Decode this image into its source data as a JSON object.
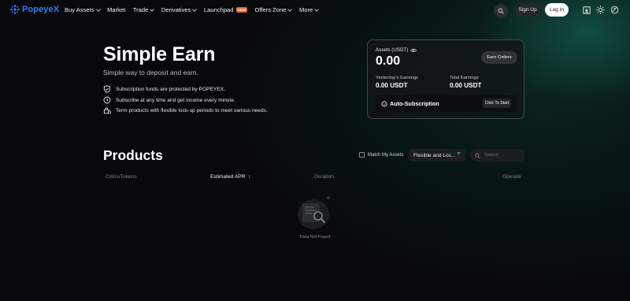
{
  "brand": {
    "name": "PopeyeX",
    "accent": "#2f7fff"
  },
  "nav": {
    "items": [
      {
        "label": "Buy Assets",
        "dropdown": true
      },
      {
        "label": "Market",
        "dropdown": false
      },
      {
        "label": "Trade",
        "dropdown": true
      },
      {
        "label": "Derivatives",
        "dropdown": true
      },
      {
        "label": "Launchpad",
        "dropdown": false,
        "badge": "NEW"
      },
      {
        "label": "Offers Zone",
        "dropdown": true
      },
      {
        "label": "More",
        "dropdown": true
      }
    ],
    "signup": "Sign Up",
    "login": "Log In"
  },
  "hero": {
    "title": "Simple Earn",
    "subtitle": "Simple way to deposit and earn.",
    "features": [
      {
        "icon": "shield-check-icon",
        "text": "Subscription funds are protected by POPEYEX."
      },
      {
        "icon": "clock-coin-icon",
        "text": "Subscribe at any time and get income every minute."
      },
      {
        "icon": "lock-clock-icon",
        "text": "Term products with flexible lock-up periods to meet various needs."
      }
    ]
  },
  "assets_card": {
    "assets_label": "Assets (USDT)",
    "assets_value": "0.00",
    "earn_orders": "Earn Orders",
    "yesterday_label": "Yesterday's Earnings",
    "yesterday_value": "0.00 USDT",
    "total_label": "Total Earnings",
    "total_value": "0.00 USDT",
    "auto_sub_label": "Auto-Subscription",
    "auto_sub_button": "Click To Start"
  },
  "products": {
    "title": "Products",
    "match_label": "Match My Assets",
    "select_value": "Flexible and Loc...",
    "search_placeholder": "Search",
    "columns": {
      "coins": "Coins/Tokens",
      "apr": "Estimated APR",
      "duration": "Duration",
      "operate": "Operate"
    },
    "empty_text": "Data Not Found"
  }
}
